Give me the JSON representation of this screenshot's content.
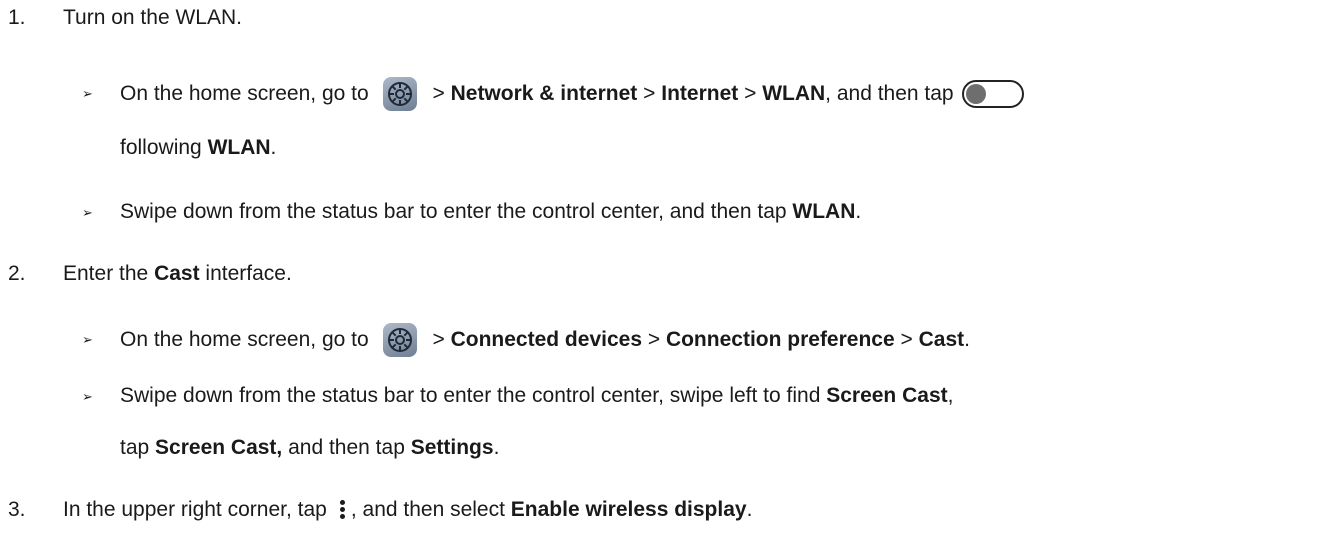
{
  "steps": [
    {
      "number": "1.",
      "text": "Turn on the WLAN.",
      "subs": [
        {
          "bullet": "➢",
          "line1": {
            "p1": "On the home screen, go to",
            "p2": " > ",
            "b1": "Network & internet",
            "p3": " > ",
            "b2": "Internet",
            "p4": " > ",
            "b3": "WLAN",
            "p5": ", and then tap"
          },
          "line2": {
            "p1": "following ",
            "b1": "WLAN",
            "p2": "."
          }
        },
        {
          "bullet": "➢",
          "line1": {
            "p1": "Swipe down from the status bar to enter the control center, and then tap ",
            "b1": "WLAN",
            "p2": "."
          }
        }
      ]
    },
    {
      "number": "2.",
      "text_plain1": "Enter the ",
      "text_bold": "Cast",
      "text_plain2": " interface.",
      "subs": [
        {
          "bullet": "➢",
          "line1": {
            "p1": "On the home screen, go to",
            "p2": " > ",
            "b1": "Connected devices",
            "p3": " > ",
            "b2": "Connection preference",
            "p4": " > ",
            "b3": "Cast",
            "p5": "."
          }
        },
        {
          "bullet": "➢",
          "line1": {
            "p1": "Swipe down from the status bar to enter the control center, swipe left to find ",
            "b1": "Screen Cast",
            "p2": ","
          },
          "line2": {
            "p1": "tap ",
            "b1": "Screen Cast,",
            "p2": " and then tap ",
            "b2": "Settings",
            "p3": "."
          }
        }
      ]
    },
    {
      "number": "3.",
      "text_plain1": "In the upper right corner, tap",
      "text_plain2": ", and then select ",
      "text_bold": "Enable wireless display",
      "text_plain3": "."
    }
  ],
  "icons": {
    "settings": "settings-gear-icon",
    "toggle": "toggle-switch-off-icon",
    "more": "more-vertical-icon"
  },
  "colors": {
    "text": "#1a1a1a",
    "settings_icon_bg": "#8a98ab",
    "toggle_knob": "#6e6e6e"
  }
}
